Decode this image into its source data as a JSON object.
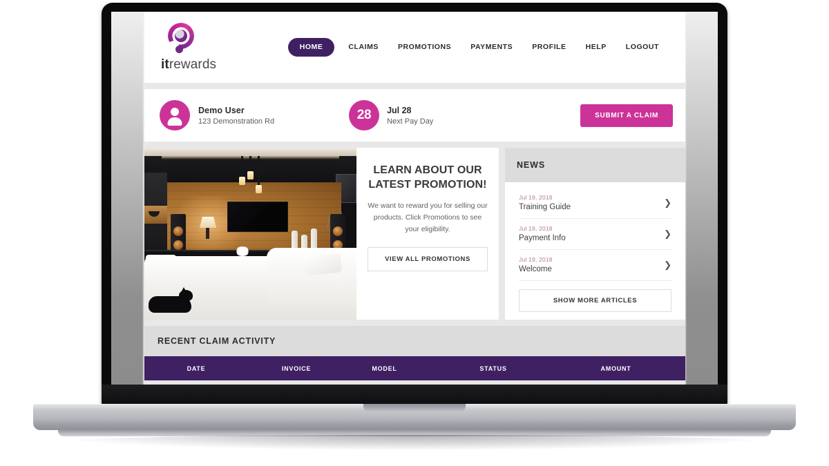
{
  "brand": {
    "name_bold": "it",
    "name_rest": "rewards",
    "logo_icon": "itrewards-logo-icon"
  },
  "nav": {
    "items": [
      {
        "label": "HOME",
        "active": true
      },
      {
        "label": "CLAIMS",
        "active": false
      },
      {
        "label": "PROMOTIONS",
        "active": false
      },
      {
        "label": "PAYMENTS",
        "active": false
      },
      {
        "label": "PROFILE",
        "active": false
      },
      {
        "label": "HELP",
        "active": false
      },
      {
        "label": "LOGOUT",
        "active": false
      }
    ]
  },
  "user_bar": {
    "avatar_icon": "user-avatar-icon",
    "name": "Demo User",
    "address": "123 Demonstration Rd",
    "payday_day": "28",
    "payday_date": "Jul 28",
    "payday_label": "Next Pay Day",
    "submit_claim_label": "SUBMIT A CLAIM"
  },
  "promo": {
    "image_alt": "modern-living-room-photo",
    "title": "LEARN ABOUT OUR LATEST PROMOTION!",
    "body": "We want to reward you for selling our products. Click Promotions to see your eligibility.",
    "button_label": "VIEW ALL PROMOTIONS"
  },
  "news": {
    "heading": "NEWS",
    "items": [
      {
        "date": "Jul 19, 2018",
        "title": "Training Guide",
        "chevron": "chevron-right-icon"
      },
      {
        "date": "Jul 19, 2018",
        "title": "Payment Info",
        "chevron": "chevron-right-icon"
      },
      {
        "date": "Jul 19, 2018",
        "title": "Welcome",
        "chevron": "chevron-right-icon"
      }
    ],
    "show_more_label": "SHOW MORE ARTICLES"
  },
  "claims": {
    "heading": "RECENT CLAIM ACTIVITY",
    "columns": [
      "DATE",
      "INVOICE",
      "MODEL",
      "STATUS",
      "AMOUNT"
    ],
    "rows": []
  },
  "colors": {
    "brand_purple": "#3f2063",
    "brand_magenta": "#cc3399",
    "page_bg": "#e8e8e8",
    "panel_header_gray": "#dcdcdc",
    "news_date": "#b07c8f"
  }
}
